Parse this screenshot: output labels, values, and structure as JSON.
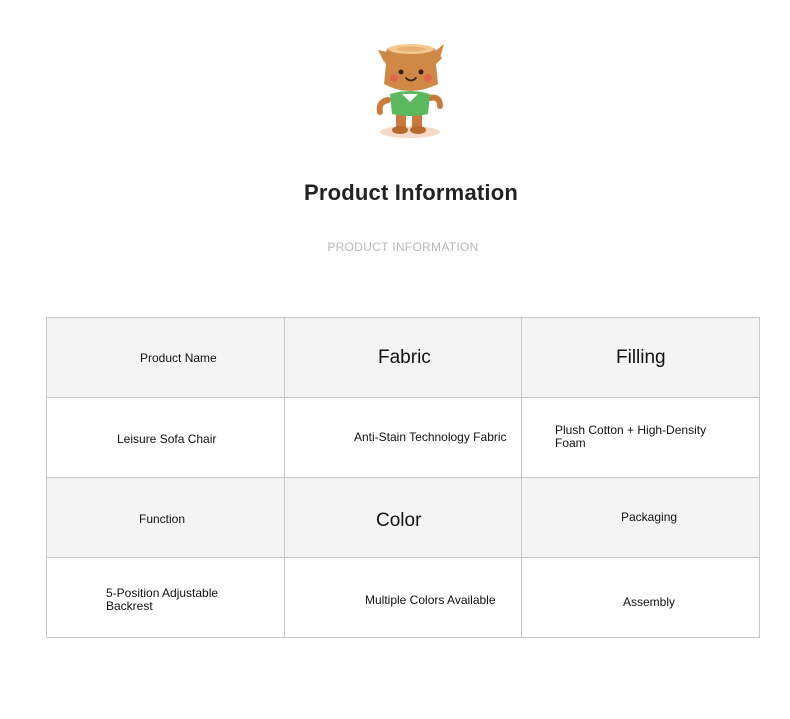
{
  "header": {
    "title": "Product Information",
    "subtitle": "PRODUCT INFORMATION",
    "mascot_icon": "tree-stump-mascot-icon"
  },
  "table": {
    "rows": [
      {
        "cells": [
          "Product Name",
          "Fabric",
          "Filling"
        ]
      },
      {
        "cells": [
          "Leisure Sofa Chair",
          "Anti-Stain Technology Fabric",
          "Plush Cotton + High-Density Foam"
        ]
      },
      {
        "cells": [
          "Function",
          "Color",
          "Packaging"
        ]
      },
      {
        "cells": [
          "5-Position Adjustable Backrest",
          "Multiple Colors Available",
          "Assembly"
        ]
      }
    ]
  },
  "colors": {
    "shaded_row": "#f4f4f4",
    "border": "#c8c8c8",
    "title": "#222222",
    "subtitle": "#b8b8b8"
  }
}
